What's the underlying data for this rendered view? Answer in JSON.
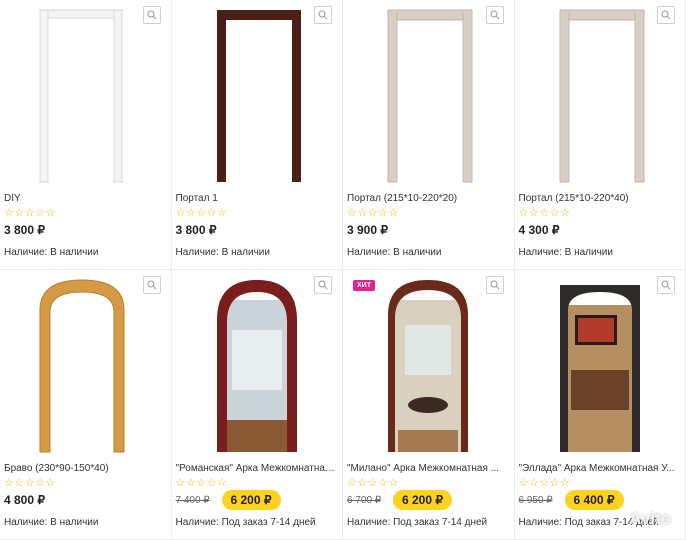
{
  "products": [
    {
      "title": "DIY",
      "stars": "☆☆☆☆☆",
      "price": "3 800 ₽",
      "availability": "Наличие: В наличии"
    },
    {
      "title": "Портал 1",
      "stars": "☆☆☆☆☆",
      "price": "3 800 ₽",
      "availability": "Наличие: В наличии"
    },
    {
      "title": "Портал (215*10-220*20)",
      "stars": "☆☆☆☆☆",
      "price": "3 900 ₽",
      "availability": "Наличие: В наличии"
    },
    {
      "title": "Портал (215*10-220*40)",
      "stars": "☆☆☆☆☆",
      "price": "4 300 ₽",
      "availability": "Наличие: В наличии"
    },
    {
      "title": "Браво (230*90-150*40)",
      "stars": "☆☆☆☆☆",
      "price": "4 800 ₽",
      "availability": "Наличие: В наличии"
    },
    {
      "title": "\"Романская\" Арка Межкомнатная ...",
      "stars": "☆☆☆☆☆",
      "old_price": "7 400 ₽",
      "price": "6 200 ₽",
      "availability": "Наличие: Под заказ 7-14 дней"
    },
    {
      "title": "\"Милано\" Арка Межкомнатная ...",
      "stars": "☆☆☆☆☆",
      "old_price": "6 700 ₽",
      "price": "6 200 ₽",
      "availability": "Наличие: Под заказ 7-14 дней",
      "badge": "ХИТ"
    },
    {
      "title": "\"Эллада\" Арка Межкомнатная У...",
      "stars": "☆☆☆☆☆",
      "old_price": "6 950 ₽",
      "price": "6 400 ₽",
      "availability": "Наличие: Под заказ 7-14 дней"
    }
  ],
  "watermark": "Avito",
  "colors": {
    "accent_yellow": "#ffd21f",
    "badge_pink": "#e4238f",
    "star": "#f4b400"
  }
}
